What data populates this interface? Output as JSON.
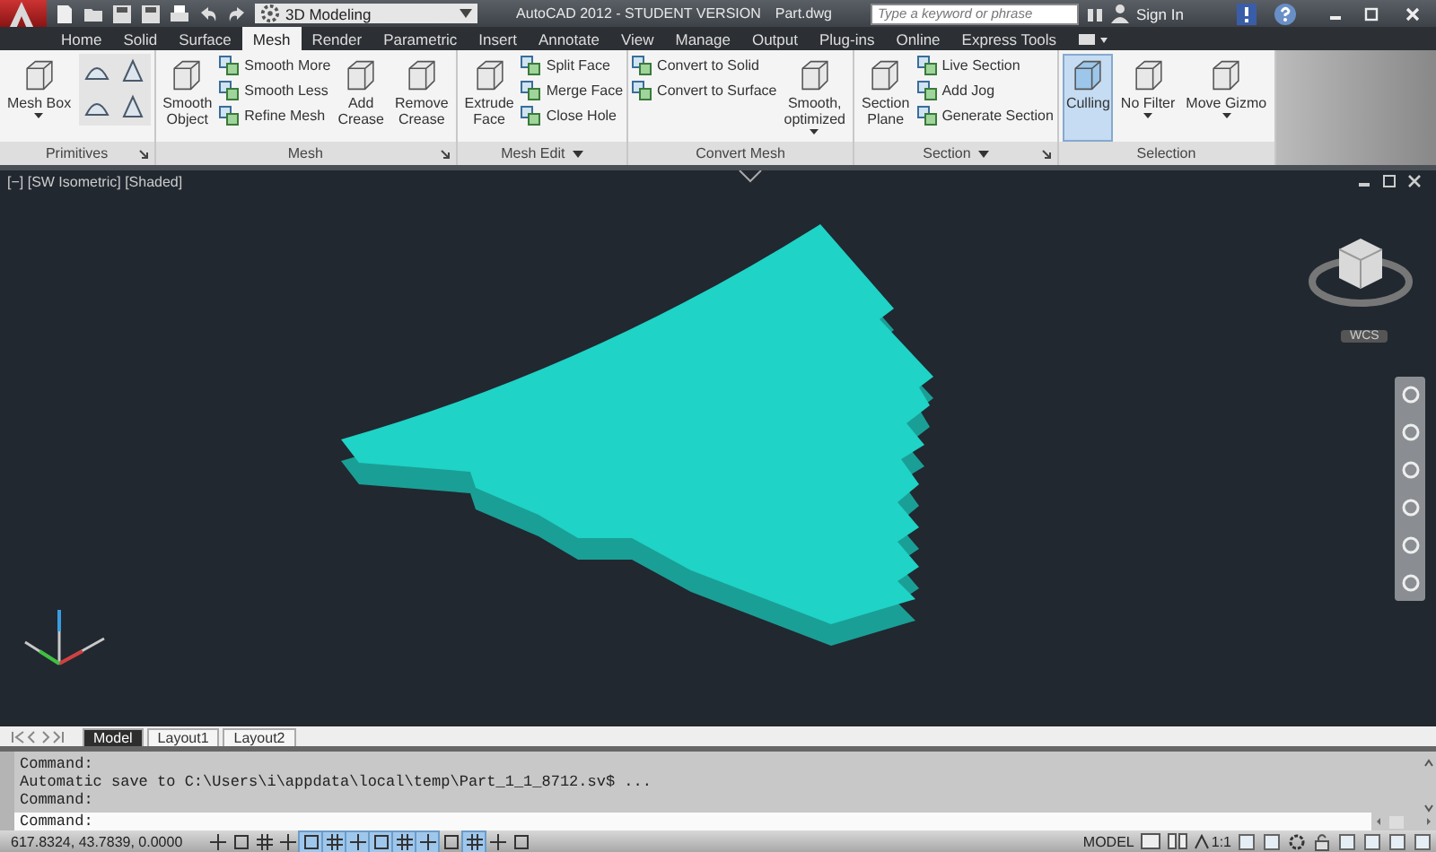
{
  "title_bar": {
    "workspace": "3D Modeling",
    "app_title": "AutoCAD 2012 - STUDENT VERSION",
    "file_name": "Part.dwg",
    "search_placeholder": "Type a keyword or phrase",
    "sign_in": "Sign In"
  },
  "tabs": [
    {
      "label": "Home",
      "selected": false
    },
    {
      "label": "Solid",
      "selected": false
    },
    {
      "label": "Surface",
      "selected": false
    },
    {
      "label": "Mesh",
      "selected": true
    },
    {
      "label": "Render",
      "selected": false
    },
    {
      "label": "Parametric",
      "selected": false
    },
    {
      "label": "Insert",
      "selected": false
    },
    {
      "label": "Annotate",
      "selected": false
    },
    {
      "label": "View",
      "selected": false
    },
    {
      "label": "Manage",
      "selected": false
    },
    {
      "label": "Output",
      "selected": false
    },
    {
      "label": "Plug-ins",
      "selected": false
    },
    {
      "label": "Online",
      "selected": false
    },
    {
      "label": "Express Tools",
      "selected": false
    }
  ],
  "ribbon": [
    {
      "name": "Primitives",
      "expandable": false,
      "launcher": true,
      "columns": [
        {
          "kind": "large",
          "label": "Mesh Box",
          "dropdown": true,
          "on": false
        },
        {
          "kind": "icons"
        }
      ]
    },
    {
      "name": "Mesh",
      "expandable": false,
      "launcher": true,
      "columns": [
        {
          "kind": "large",
          "label": "Smooth\nObject",
          "dropdown": false,
          "on": false
        },
        {
          "kind": "stack",
          "items": [
            {
              "label": "Smooth More"
            },
            {
              "label": "Smooth Less"
            },
            {
              "label": "Refine Mesh"
            }
          ]
        },
        {
          "kind": "large",
          "label": "Add\nCrease",
          "dropdown": false,
          "on": false
        },
        {
          "kind": "large",
          "label": "Remove\nCrease",
          "dropdown": false,
          "on": false
        }
      ]
    },
    {
      "name": "Mesh Edit",
      "expandable": true,
      "launcher": false,
      "columns": [
        {
          "kind": "large",
          "label": "Extrude\nFace",
          "dropdown": false,
          "on": false
        },
        {
          "kind": "stack",
          "items": [
            {
              "label": "Split Face"
            },
            {
              "label": "Merge Face"
            },
            {
              "label": "Close Hole"
            }
          ]
        }
      ]
    },
    {
      "name": "Convert Mesh",
      "expandable": false,
      "launcher": false,
      "columns": [
        {
          "kind": "stack",
          "items": [
            {
              "label": "Convert to Solid"
            },
            {
              "label": "Convert to Surface"
            }
          ]
        },
        {
          "kind": "large",
          "label": "Smooth,\noptimized",
          "dropdown": true,
          "on": false
        }
      ]
    },
    {
      "name": "Section",
      "expandable": true,
      "launcher": true,
      "columns": [
        {
          "kind": "large",
          "label": "Section\nPlane",
          "dropdown": false,
          "on": false
        },
        {
          "kind": "stack",
          "items": [
            {
              "label": "Live Section"
            },
            {
              "label": "Add Jog"
            },
            {
              "label": "Generate Section"
            }
          ]
        }
      ]
    },
    {
      "name": "Selection",
      "expandable": false,
      "launcher": false,
      "columns": [
        {
          "kind": "large",
          "label": "Culling",
          "dropdown": false,
          "on": true
        },
        {
          "kind": "large",
          "label": "No Filter",
          "dropdown": true,
          "on": false
        },
        {
          "kind": "large",
          "label": "Move Gizmo",
          "dropdown": true,
          "on": false
        }
      ]
    }
  ],
  "viewport": {
    "label": "[−] [SW Isometric] [Shaded]",
    "viewcube_label": "WCS"
  },
  "layout_tabs": [
    {
      "label": "Model",
      "selected": true
    },
    {
      "label": "Layout1",
      "selected": false
    },
    {
      "label": "Layout2",
      "selected": false
    }
  ],
  "command_history": [
    "Command:",
    "Automatic save to C:\\Users\\i\\appdata\\local\\temp\\Part_1_1_8712.sv$ ...",
    "Command:"
  ],
  "command_prompt": "Command:",
  "status_bar": {
    "coordinates": "617.8324, 43.7839, 0.0000",
    "toggles": [
      {
        "on": false
      },
      {
        "on": false
      },
      {
        "on": false
      },
      {
        "on": false
      },
      {
        "on": true
      },
      {
        "on": true
      },
      {
        "on": true
      },
      {
        "on": true
      },
      {
        "on": true
      },
      {
        "on": true
      },
      {
        "on": false
      },
      {
        "on": true
      },
      {
        "on": false
      },
      {
        "on": false
      }
    ],
    "space": "MODEL",
    "scale": "1:1"
  }
}
